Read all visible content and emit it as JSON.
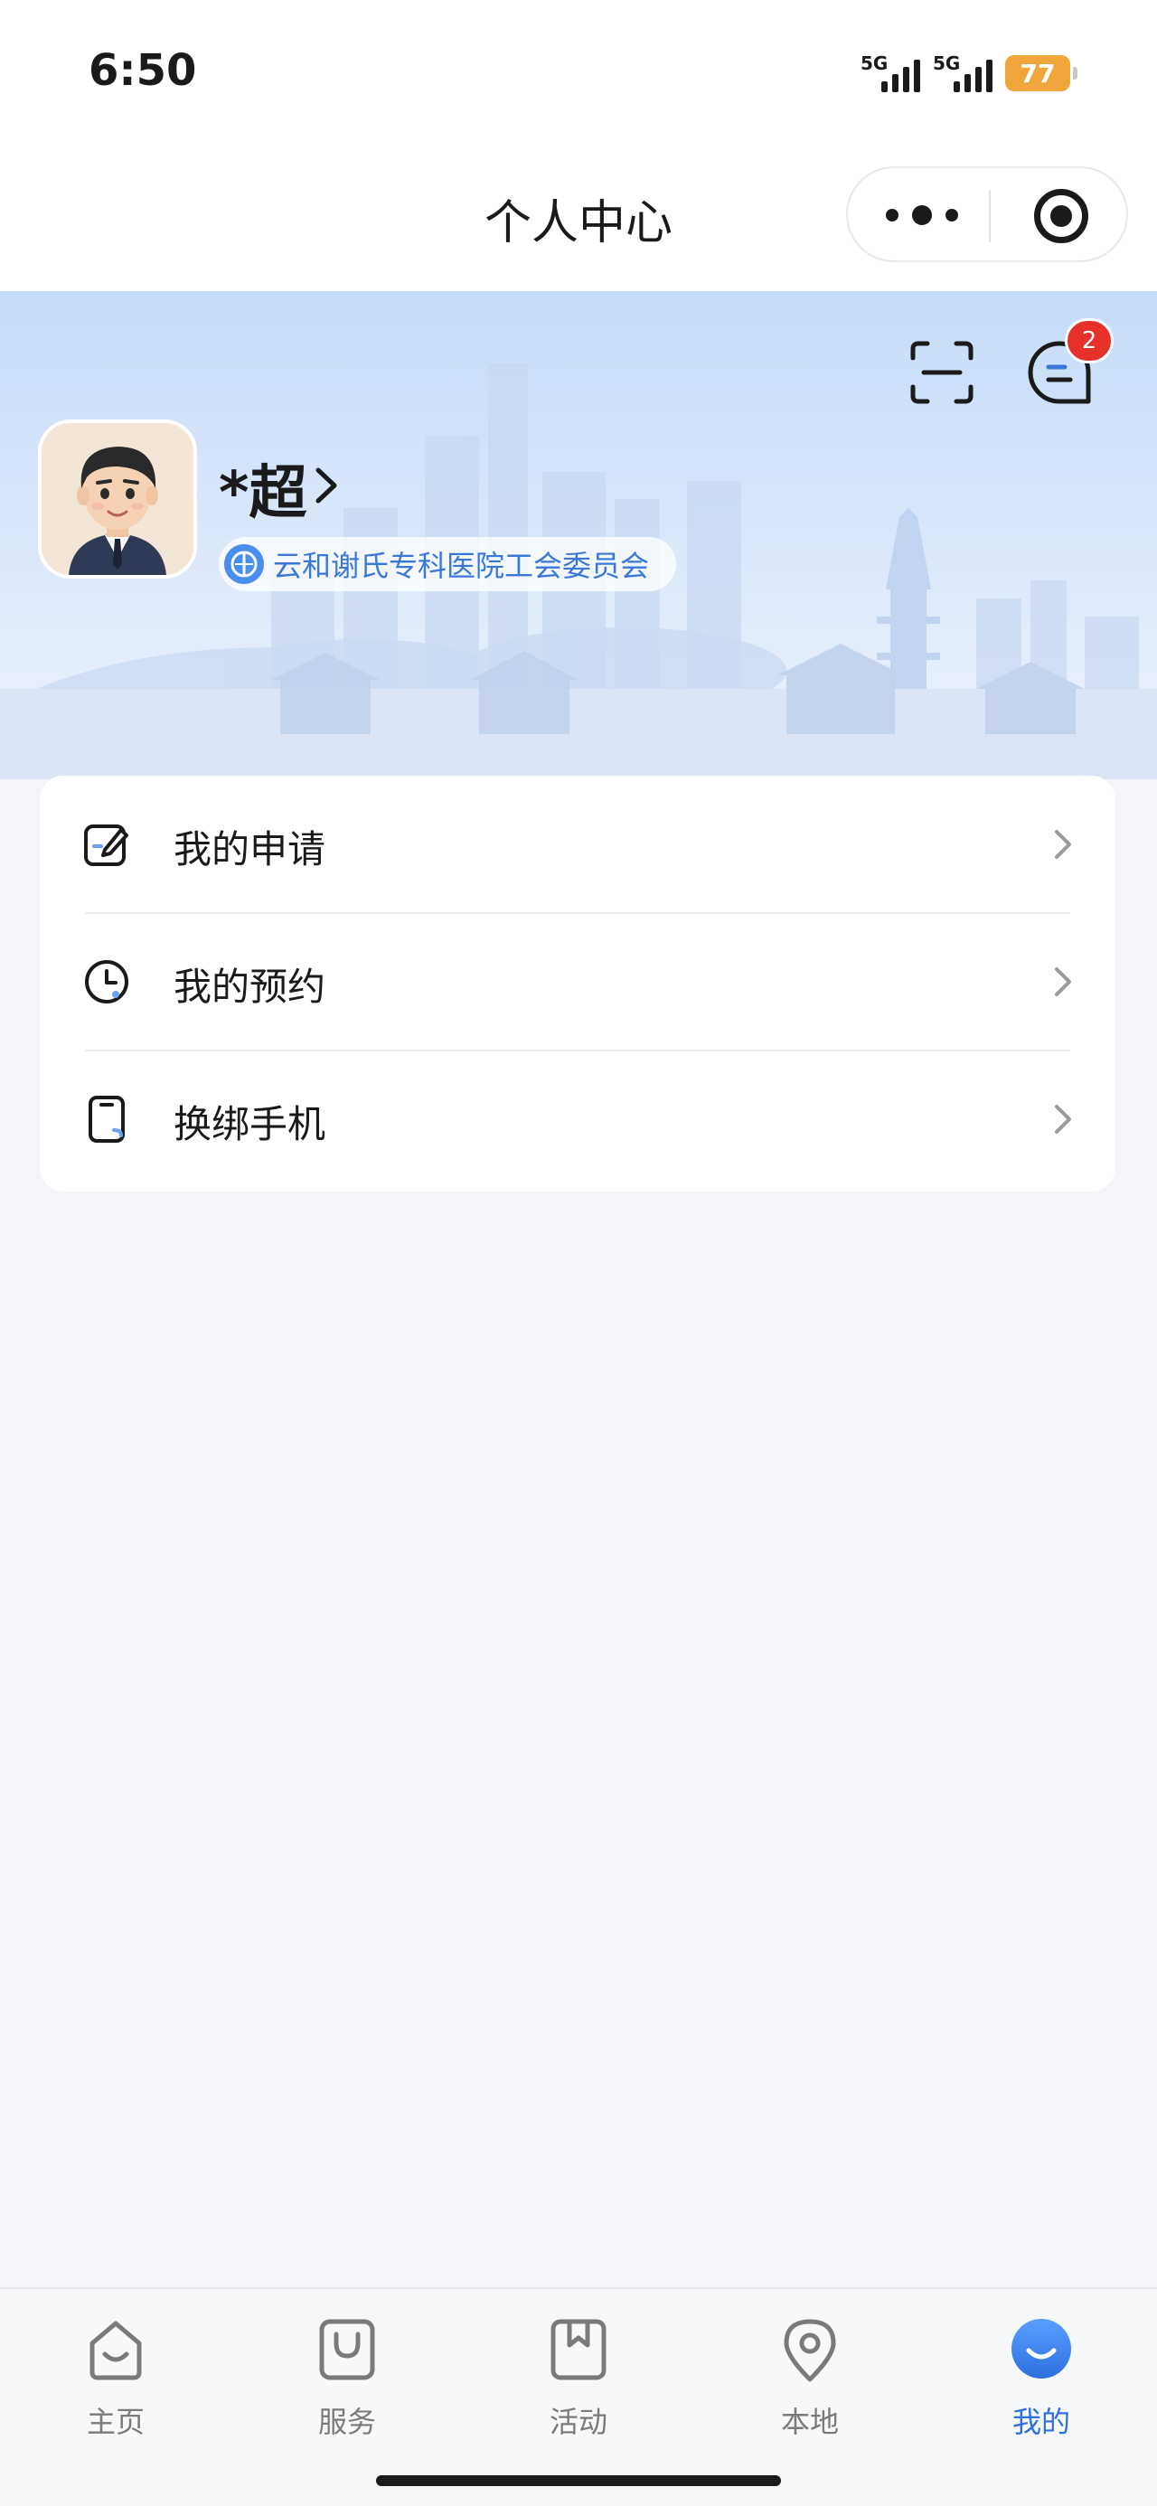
{
  "status_bar": {
    "time": "6:50",
    "signal_1": "5G",
    "signal_2": "5G",
    "battery": "77",
    "battery_color": "#f0a63a"
  },
  "nav": {
    "title": "个人中心",
    "more_icon": "more-dots-icon",
    "target_icon": "target-icon"
  },
  "header": {
    "user_name": "*超",
    "org_name": "云和谢氏专科医院工会委员会",
    "unread_badge": "2",
    "scan_icon": "scan-icon",
    "message_icon": "message-icon",
    "accent_color": "#3a78d8"
  },
  "menu": {
    "items": [
      {
        "label": "我的申请",
        "icon": "edit-icon"
      },
      {
        "label": "我的预约",
        "icon": "clock-icon"
      },
      {
        "label": "换绑手机",
        "icon": "phone-icon"
      }
    ]
  },
  "tabs": {
    "items": [
      {
        "label": "主页",
        "icon": "home-icon",
        "active": false
      },
      {
        "label": "服务",
        "icon": "bag-icon",
        "active": false
      },
      {
        "label": "活动",
        "icon": "bookmark-icon",
        "active": false
      },
      {
        "label": "本地",
        "icon": "location-icon",
        "active": false
      },
      {
        "label": "我的",
        "icon": "profile-icon",
        "active": true
      }
    ],
    "active_color": "#2e6fe0",
    "inactive_color": "#7a7a7a"
  }
}
